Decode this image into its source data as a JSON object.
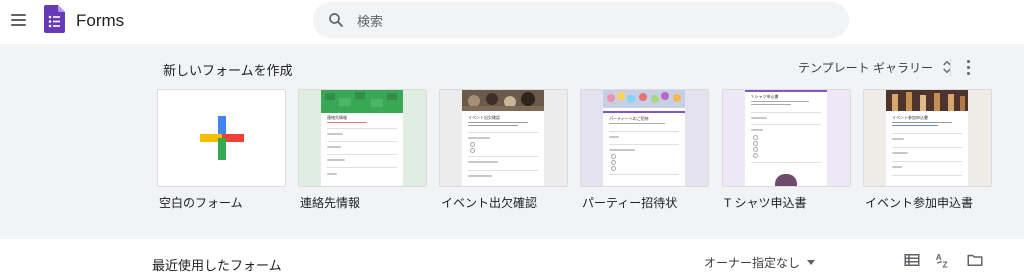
{
  "header": {
    "app_title": "Forms",
    "menu_icon": "hamburger-menu-icon",
    "logo_icon": "forms-logo-icon"
  },
  "search": {
    "placeholder": "検索",
    "value": "",
    "icon": "search-icon"
  },
  "start_section": {
    "title": "新しいフォームを作成",
    "gallery_label": "テンプレート ギャラリー",
    "gallery_icon": "unfold-more-icon",
    "more_icon": "more-vertical-icon",
    "templates": [
      {
        "label": "空白のフォーム",
        "thumb_title": ""
      },
      {
        "label": "連絡先情報",
        "thumb_title": "連絡先情報"
      },
      {
        "label": "イベント出欠確認",
        "thumb_title": "イベント出欠確認"
      },
      {
        "label": "パーティー招待状",
        "thumb_title": "パーティーへのご招待"
      },
      {
        "label": "T シャツ申込書",
        "thumb_title": "T シャツ申込書"
      },
      {
        "label": "イベント参加申込書",
        "thumb_title": "イベント参加申込書"
      }
    ]
  },
  "recent_section": {
    "title": "最近使用したフォーム",
    "owner_filter": "オーナー指定なし",
    "owner_filter_icon": "arrow-drop-down-icon",
    "list_view_icon": "list-view-icon",
    "sort_icon": "sort-az-icon",
    "folder_icon": "folder-icon"
  },
  "colors": {
    "forms_purple": "#673ab7",
    "panel_background": "#f1f3f4",
    "search_background": "#f1f3f4",
    "plus_blue": "#4285f4",
    "plus_red": "#ea4335",
    "plus_yellow": "#fbbc04",
    "plus_green": "#34a853",
    "contact_green": "#3aa757"
  }
}
